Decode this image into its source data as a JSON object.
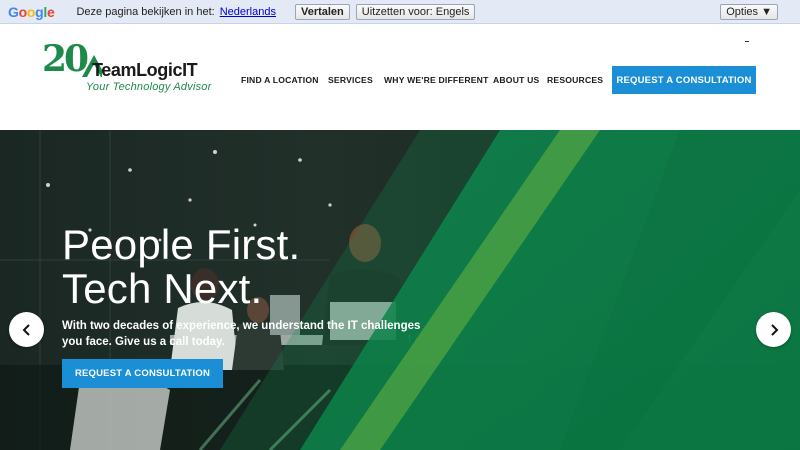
{
  "translate_bar": {
    "logo": "Google",
    "prompt": "Deze pagina bekijken in het:",
    "language_link": "Nederlands",
    "translate_button": "Vertalen",
    "off_button": "Uitzetten voor: Engels",
    "options_button": "Opties ▼"
  },
  "header": {
    "logo": {
      "anniversary": "20",
      "brand": "TeamLogicIT",
      "tagline": "Your Technology Advisor"
    },
    "nav": [
      {
        "label": "FIND A LOCATION"
      },
      {
        "label": "SERVICES"
      },
      {
        "label": "WHY WE'RE DIFFERENT"
      },
      {
        "label": "ABOUT US"
      },
      {
        "label": "RESOURCES"
      }
    ],
    "cta": "REQUEST A CONSULTATION"
  },
  "hero": {
    "title": "People First.\nTech Next.",
    "text": "With two decades of experience, we understand the IT challenges you face. Give us a call today.",
    "cta": "REQUEST A CONSULTATION",
    "prev_icon": "chevron-left-icon",
    "next_icon": "chevron-right-icon"
  },
  "colors": {
    "accent_blue": "#1a8fd6",
    "brand_green": "#1e8a4a",
    "hero_overlay_green": "#0e8a4f",
    "translate_bar_bg": "#e3e9f5"
  }
}
